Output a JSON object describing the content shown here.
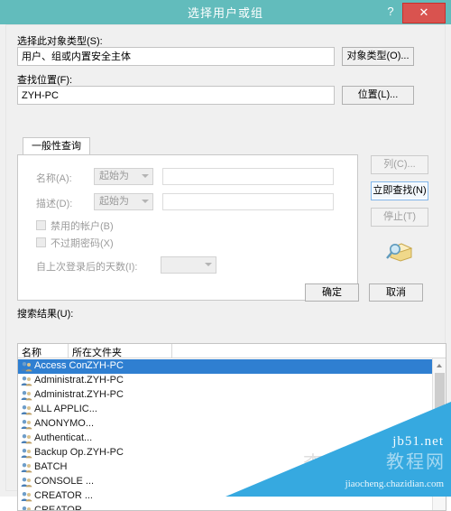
{
  "titlebar": {
    "title": "选择用户或组",
    "help_label": "?",
    "close_label": "✕",
    "bg_color": "#62bcbc",
    "close_color": "#d9534f"
  },
  "object_type": {
    "label": "选择此对象类型(S):",
    "value": "用户、组或内置安全主体",
    "button": "对象类型(O)..."
  },
  "location": {
    "label": "查找位置(F):",
    "value": "ZYH-PC",
    "button": "位置(L)..."
  },
  "tabs": [
    {
      "label": "一般性查询",
      "active": true
    }
  ],
  "query": {
    "name_label": "名称(A):",
    "name_operator": "起始为",
    "name_value": "",
    "desc_label": "描述(D):",
    "desc_operator": "起始为",
    "desc_value": "",
    "disabled_accounts_label": "禁用的帐户(B)",
    "disabled_accounts_checked": false,
    "non_expiring_password_label": "不过期密码(X)",
    "non_expiring_password_checked": false,
    "days_since_logon_label": "自上次登录后的天数(I):",
    "days_since_logon_value": ""
  },
  "side_buttons": {
    "columns": "列(C)...",
    "find_now": "立即查找(N)",
    "stop": "停止(T)"
  },
  "dialog_buttons": {
    "ok": "确定",
    "cancel": "取消"
  },
  "results": {
    "label": "搜索结果(U):",
    "columns": [
      "名称",
      "所在文件夹"
    ],
    "rows": [
      {
        "name": "Access Con...",
        "folder": "ZYH-PC",
        "selected": true
      },
      {
        "name": "Administrat...",
        "folder": "ZYH-PC",
        "selected": false
      },
      {
        "name": "Administrat...",
        "folder": "ZYH-PC",
        "selected": false
      },
      {
        "name": "ALL APPLIC...",
        "folder": "",
        "selected": false
      },
      {
        "name": "ANONYMO...",
        "folder": "",
        "selected": false
      },
      {
        "name": "Authenticat...",
        "folder": "",
        "selected": false
      },
      {
        "name": "Backup Op...",
        "folder": "ZYH-PC",
        "selected": false
      },
      {
        "name": "BATCH",
        "folder": "",
        "selected": false
      },
      {
        "name": "CONSOLE ...",
        "folder": "",
        "selected": false
      },
      {
        "name": "CREATOR ...",
        "folder": "",
        "selected": false
      },
      {
        "name": "CREATOR ...",
        "folder": "",
        "selected": false
      }
    ],
    "selection_color": "#2f7fd1"
  },
  "watermark": {
    "line1": "jb51.net",
    "line2": "教程网",
    "line3": "jiaocheng.chazidian.com",
    "ghost": "查字典",
    "band_color": "#36a9e0"
  }
}
